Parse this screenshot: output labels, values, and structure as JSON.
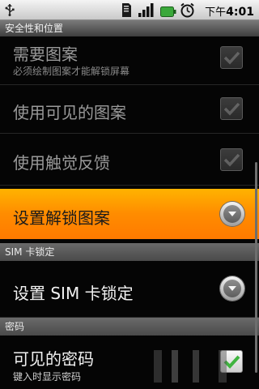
{
  "status_bar": {
    "time_prefix": "下午",
    "time": "4:01",
    "icons": [
      "usb-icon",
      "sd-card-icon",
      "signal-icon",
      "battery-icon",
      "alarm-icon"
    ]
  },
  "window": {
    "title": "安全性和位置"
  },
  "preferences": {
    "require_pattern": {
      "title": "需要图案",
      "summary": "必须绘制图案才能解锁屏幕",
      "checked": true,
      "enabled": false
    },
    "visible_pattern": {
      "title": "使用可见的图案",
      "checked": true,
      "enabled": false
    },
    "tactile_feedback": {
      "title": "使用触觉反馈",
      "checked": true,
      "enabled": false
    },
    "set_unlock_pattern": {
      "title": "设置解锁图案"
    }
  },
  "sim_section": {
    "header": "SIM 卡锁定",
    "set_sim_lock": {
      "title": "设置 SIM 卡锁定"
    }
  },
  "password_section": {
    "header": "密码",
    "visible_passwords": {
      "title": "可见的密码",
      "summary": "键入时显示密码",
      "checked": true
    }
  },
  "colors": {
    "highlight": "#ff8c00",
    "check": "#4caf50"
  }
}
